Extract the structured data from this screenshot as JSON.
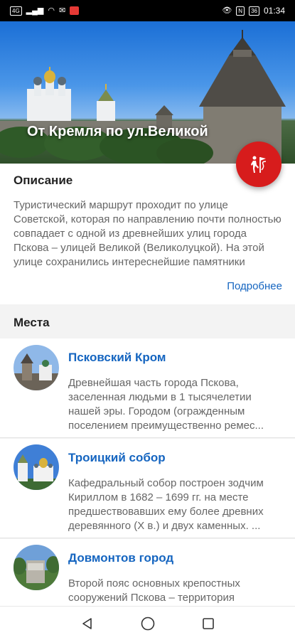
{
  "status_bar": {
    "left_icons": [
      "sim-icon",
      "signal-icon",
      "wifi-icon",
      "mail-icon",
      "notification-icon"
    ],
    "right_icons": [
      "eye-icon",
      "nfc-icon"
    ],
    "battery": "36",
    "time": "01:34"
  },
  "hero": {
    "title": "От Кремля по ул.Великой"
  },
  "fab": {
    "icon": "route-walk-icon",
    "color": "#d71c1c"
  },
  "description": {
    "title": "Описание",
    "text": "Туристический маршрут проходит по улице Советской, которая по направлению почти полностью совпадает с одной из древнейших улиц города Пскова – улицей Великой (Великолуцкой). На этой улице сохранились интереснейшие памятники разных исторически...",
    "more_label": "Подробнее"
  },
  "places": {
    "title": "Места",
    "items": [
      {
        "name": "Псковский Кром",
        "description": "Древнейшая часть города Пскова, заселенная людьми в 1 тысячелетии нашей эры. Городом (огражденным поселением преимущественно ремес..."
      },
      {
        "name": "Троицкий собор",
        "description": "Кафедральный собор построен зодчим Кириллом в 1682 – 1699 гг. на месте предшествовавших ему более древних деревянного (X в.) и двух каменных. ..."
      },
      {
        "name": "Довмонтов город",
        "description": "Второй пояс основных крепостных сооружений Пскова – территория"
      }
    ]
  },
  "colors": {
    "accent": "#1565c0",
    "fab": "#d71c1c"
  }
}
